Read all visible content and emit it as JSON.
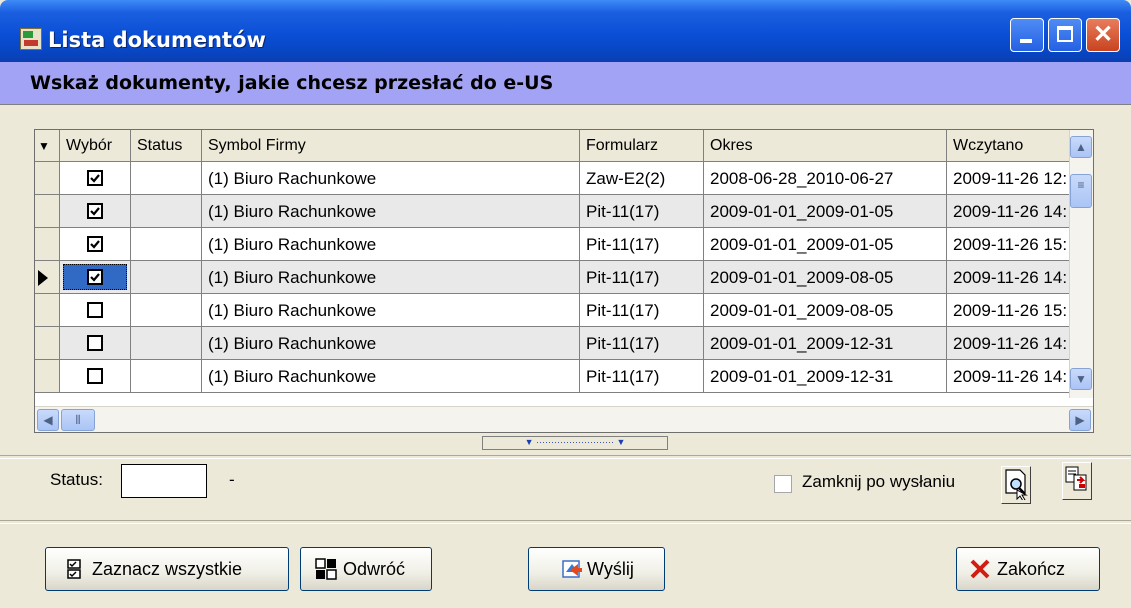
{
  "window": {
    "title": "Lista dokumentów"
  },
  "banner": {
    "text": "Wskaż dokumenty, jakie chcesz przesłać do e-US"
  },
  "grid": {
    "indicator_header": "▼",
    "columns": [
      "Wybór",
      "Status",
      "Symbol Firmy",
      "Formularz",
      "Okres",
      "Wczytano"
    ],
    "rows": [
      {
        "selected": "☑",
        "status": "",
        "symbol": "(1) Biuro Rachunkowe",
        "form": "Zaw-E2(2)",
        "period": "2008-06-28_2010-06-27",
        "loaded": "2009-11-26 12:"
      },
      {
        "selected": "☑",
        "status": "",
        "symbol": "(1) Biuro Rachunkowe",
        "form": "Pit-11(17)",
        "period": "2009-01-01_2009-01-05",
        "loaded": "2009-11-26 14:"
      },
      {
        "selected": "☑",
        "status": "",
        "symbol": "(1) Biuro Rachunkowe",
        "form": "Pit-11(17)",
        "period": "2009-01-01_2009-01-05",
        "loaded": "2009-11-26 15:"
      },
      {
        "selected": "☑",
        "status": "",
        "symbol": "(1) Biuro Rachunkowe",
        "form": "Pit-11(17)",
        "period": "2009-01-01_2009-08-05",
        "loaded": "2009-11-26 14:"
      },
      {
        "selected": "☐",
        "status": "",
        "symbol": "(1) Biuro Rachunkowe",
        "form": "Pit-11(17)",
        "period": "2009-01-01_2009-08-05",
        "loaded": "2009-11-26 15:"
      },
      {
        "selected": "☐",
        "status": "",
        "symbol": "(1) Biuro Rachunkowe",
        "form": "Pit-11(17)",
        "period": "2009-01-01_2009-12-31",
        "loaded": "2009-11-26 14:"
      },
      {
        "selected": "☐",
        "status": "",
        "symbol": "(1) Biuro Rachunkowe",
        "form": "Pit-11(17)",
        "period": "2009-01-01_2009-12-31",
        "loaded": "2009-11-26 14:"
      }
    ],
    "current_row": 4
  },
  "status": {
    "label": "Status:",
    "value": "",
    "dash": "-"
  },
  "close_after_send": {
    "label": "Zamknij po wysłaniu",
    "checked": false
  },
  "buttons": {
    "select_all": "Zaznacz wszystkie",
    "invert": "Odwróć",
    "send": "Wyślij",
    "finish": "Zakończ"
  },
  "colors": {
    "title_bar": "#0a4fd6",
    "banner": "#a3a3f5",
    "selection": "#316ac5"
  }
}
